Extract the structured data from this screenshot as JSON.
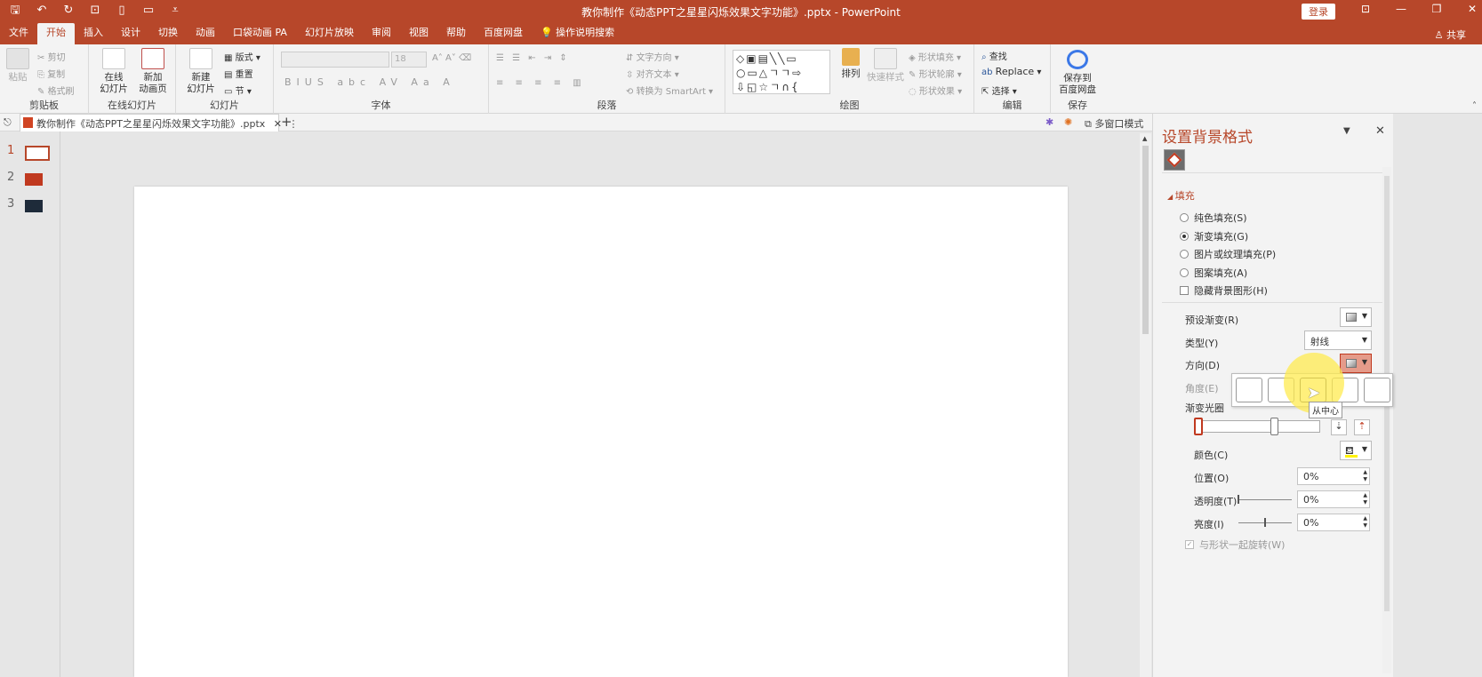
{
  "app": {
    "title": "教你制作《动态PPT之星星闪烁效果文字功能》.pptx  -  PowerPoint",
    "login_label": "登录",
    "share_label": "共享"
  },
  "qat_icons": [
    "save-icon",
    "undo-icon",
    "redo-icon",
    "present-icon",
    "new-icon",
    "open-icon",
    "customize-icon"
  ],
  "tabs": [
    "文件",
    "开始",
    "插入",
    "设计",
    "切换",
    "动画",
    "口袋动画 PA",
    "幻灯片放映",
    "审阅",
    "视图",
    "帮助",
    "百度网盘",
    "操作说明搜索"
  ],
  "ribbon": {
    "clipboard": {
      "paste": "粘贴",
      "cut": "剪切",
      "copy": "复制",
      "format_painter": "格式刷",
      "label": "剪贴板"
    },
    "online_slides": {
      "online": "在线\n幻灯片",
      "new_anim": "新加\n动画页",
      "label": "在线幻灯片"
    },
    "slides": {
      "new_slide": "新建\n幻灯片",
      "layout": "版式",
      "reset": "重置",
      "section": "节",
      "label": "幻灯片"
    },
    "font": {
      "size": "18",
      "label": "字体"
    },
    "paragraph": {
      "text_dir": "文字方向",
      "align_text": "对齐文本",
      "smartart": "转换为 SmartArt",
      "label": "段落"
    },
    "drawing": {
      "arrange": "排列",
      "quick_styles": "快速样式",
      "shape_fill": "形状填充",
      "shape_outline": "形状轮廓",
      "shape_effects": "形状效果",
      "label": "绘图"
    },
    "editing": {
      "find": "查找",
      "replace": "Replace",
      "select": "选择",
      "label": "编辑"
    },
    "save": {
      "save_baidu": "保存到\n百度网盘",
      "label": "保存"
    }
  },
  "doc_tab": {
    "name": "教你制作《动态PPT之星星闪烁效果文字功能》.pptx",
    "multi_window": "多窗口模式"
  },
  "slides": [
    {
      "num": "1"
    },
    {
      "num": "2"
    },
    {
      "num": "3"
    }
  ],
  "pane": {
    "title": "设置背景格式",
    "section": "填充",
    "fill_options": [
      {
        "label": "纯色填充(S)",
        "selected": false
      },
      {
        "label": "渐变填充(G)",
        "selected": true
      },
      {
        "label": "图片或纹理填充(P)",
        "selected": false
      },
      {
        "label": "图案填充(A)",
        "selected": false
      }
    ],
    "hide_bg": "隐藏背景图形(H)",
    "preset_gradient": "预设渐变(R)",
    "type_label": "类型(Y)",
    "type_value": "射线",
    "direction_label": "方向(D)",
    "angle_label": "角度(E)",
    "gradient_stops": "渐变光圈",
    "color_label": "颜色(C)",
    "position_label": "位置(O)",
    "position_value": "0%",
    "transparency_label": "透明度(T)",
    "transparency_value": "0%",
    "brightness_label": "亮度(I)",
    "brightness_value": "0%",
    "rotate_with_shape": "与形状一起旋转(W)",
    "tooltip": "从中心"
  }
}
